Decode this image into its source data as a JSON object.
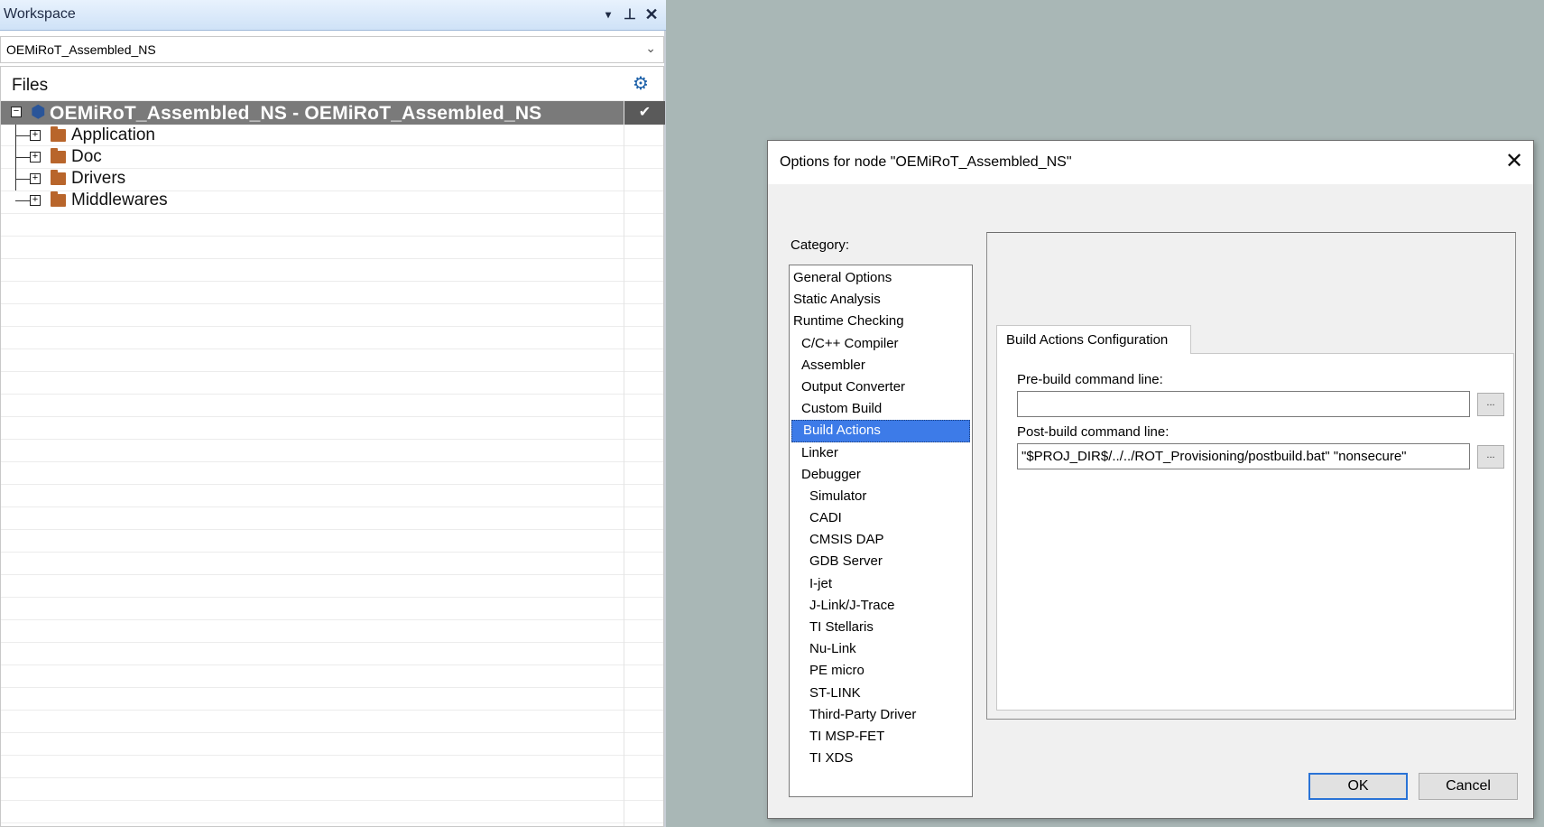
{
  "workspace": {
    "title": "Workspace",
    "dropdown_glyph": "▾",
    "pin_glyph": "⊥",
    "close_glyph": "✕",
    "config_value": "OEMiRoT_Assembled_NS",
    "config_chevron": "⌄",
    "files_header": "Files",
    "gear_glyph": "⚙",
    "root_toggle": "−",
    "root_icon": "⬢",
    "root_label": "OEMiRoT_Assembled_NS - OEMiRoT_Assembled_NS",
    "root_check": "✔",
    "item_toggle": "+",
    "items": [
      {
        "label": "Application"
      },
      {
        "label": "Doc"
      },
      {
        "label": "Drivers"
      },
      {
        "label": "Middlewares"
      }
    ]
  },
  "dialog": {
    "title": "Options for node \"OEMiRoT_Assembled_NS\"",
    "close_glyph": "✕",
    "category_label": "Category:",
    "categories": [
      {
        "label": "General Options",
        "level": 0
      },
      {
        "label": "Static Analysis",
        "level": 0
      },
      {
        "label": "Runtime Checking",
        "level": 0
      },
      {
        "label": "C/C++ Compiler",
        "level": 1
      },
      {
        "label": "Assembler",
        "level": 1
      },
      {
        "label": "Output Converter",
        "level": 1
      },
      {
        "label": "Custom Build",
        "level": 1
      },
      {
        "label": "Build Actions",
        "level": 1,
        "selected": true
      },
      {
        "label": "Linker",
        "level": 1
      },
      {
        "label": "Debugger",
        "level": 1
      },
      {
        "label": "Simulator",
        "level": 2
      },
      {
        "label": "CADI",
        "level": 2
      },
      {
        "label": "CMSIS DAP",
        "level": 2
      },
      {
        "label": "GDB Server",
        "level": 2
      },
      {
        "label": "I-jet",
        "level": 2
      },
      {
        "label": "J-Link/J-Trace",
        "level": 2
      },
      {
        "label": "TI Stellaris",
        "level": 2
      },
      {
        "label": "Nu-Link",
        "level": 2
      },
      {
        "label": "PE micro",
        "level": 2
      },
      {
        "label": "ST-LINK",
        "level": 2
      },
      {
        "label": "Third-Party Driver",
        "level": 2
      },
      {
        "label": "TI MSP-FET",
        "level": 2
      },
      {
        "label": "TI XDS",
        "level": 2
      }
    ],
    "tab_label": "Build Actions Configuration",
    "pre_build_label": "Pre-build command line:",
    "pre_build_value": "",
    "post_build_label": "Post-build command line:",
    "post_build_value": "\"$PROJ_DIR$/../../ROT_Provisioning/postbuild.bat\" \"nonsecure\"",
    "browse_label": "...",
    "ok_label": "OK",
    "cancel_label": "Cancel"
  }
}
